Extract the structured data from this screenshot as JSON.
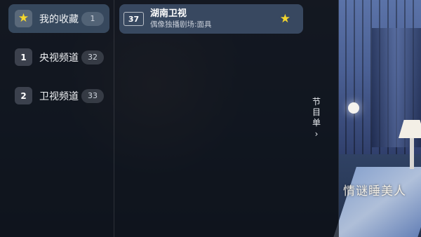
{
  "categories": [
    {
      "label": "我的收藏",
      "badge": "★",
      "count": "1",
      "active": true
    },
    {
      "label": "央视频道",
      "badge": "1",
      "count": "32",
      "active": false
    },
    {
      "label": "卫视频道",
      "badge": "2",
      "count": "33",
      "active": false
    }
  ],
  "channels": [
    {
      "number": "37",
      "name": "湖南卫视",
      "program": "偶像独播剧场:面具",
      "favorite": true
    }
  ],
  "schedule_tab": {
    "chars": [
      "节",
      "目",
      "单"
    ],
    "arrow": "›"
  },
  "watermark": "情谜睡美人",
  "colors": {
    "accent_star": "#f4d62d",
    "panel_highlight": "#465c78"
  }
}
